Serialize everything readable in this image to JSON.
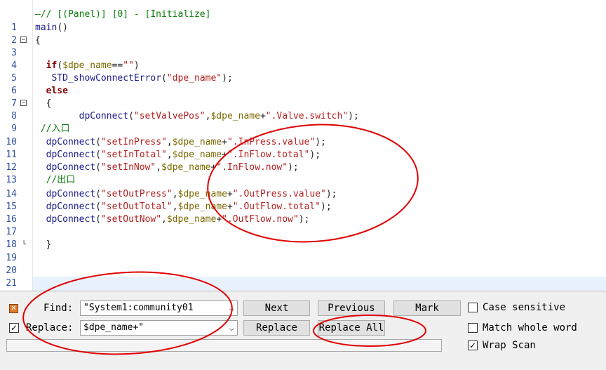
{
  "editor": {
    "lines": [
      {
        "n": "",
        "code": [
          {
            "t": "—// [(Panel)] [0] - [Initialize]",
            "c": "cm"
          }
        ]
      },
      {
        "n": "1",
        "code": [
          {
            "t": "main",
            "c": "fn"
          },
          {
            "t": "()",
            "c": "op"
          }
        ]
      },
      {
        "n": "2",
        "fold": "⊟",
        "code": [
          {
            "t": "{",
            "c": "op"
          }
        ]
      },
      {
        "n": "3",
        "code": []
      },
      {
        "n": "4",
        "code": [
          {
            "t": "  ",
            "c": "op"
          },
          {
            "t": "if",
            "c": "kw"
          },
          {
            "t": "(",
            "c": "op"
          },
          {
            "t": "$dpe_name",
            "c": "var"
          },
          {
            "t": "==",
            "c": "op"
          },
          {
            "t": "\"\"",
            "c": "str"
          },
          {
            "t": ")",
            "c": "op"
          }
        ]
      },
      {
        "n": "5",
        "code": [
          {
            "t": "   ",
            "c": "op"
          },
          {
            "t": "STD_showConnectError",
            "c": "fn"
          },
          {
            "t": "(",
            "c": "op"
          },
          {
            "t": "\"dpe_name\"",
            "c": "str"
          },
          {
            "t": ");",
            "c": "op"
          }
        ]
      },
      {
        "n": "6",
        "code": [
          {
            "t": "  ",
            "c": "op"
          },
          {
            "t": "else",
            "c": "kw"
          }
        ]
      },
      {
        "n": "7",
        "fold": "⊟",
        "code": [
          {
            "t": "  {",
            "c": "op"
          }
        ]
      },
      {
        "n": "8",
        "code": [
          {
            "t": "        ",
            "c": "op"
          },
          {
            "t": "dpConnect",
            "c": "fn"
          },
          {
            "t": "(",
            "c": "op"
          },
          {
            "t": "\"setValvePos\"",
            "c": "str"
          },
          {
            "t": ",",
            "c": "op"
          },
          {
            "t": "$dpe_name",
            "c": "var"
          },
          {
            "t": "+",
            "c": "op"
          },
          {
            "t": "\".Valve.switch\"",
            "c": "str"
          },
          {
            "t": ");",
            "c": "op"
          }
        ]
      },
      {
        "n": "9",
        "code": [
          {
            "t": " //入口",
            "c": "cm"
          }
        ]
      },
      {
        "n": "10",
        "code": [
          {
            "t": "  ",
            "c": "op"
          },
          {
            "t": "dpConnect",
            "c": "fn"
          },
          {
            "t": "(",
            "c": "op"
          },
          {
            "t": "\"setInPress\"",
            "c": "str"
          },
          {
            "t": ",",
            "c": "op"
          },
          {
            "t": "$dpe_name",
            "c": "var"
          },
          {
            "t": "+",
            "c": "op"
          },
          {
            "t": "\".InPress.value\"",
            "c": "str"
          },
          {
            "t": ");",
            "c": "op"
          }
        ]
      },
      {
        "n": "11",
        "code": [
          {
            "t": "  ",
            "c": "op"
          },
          {
            "t": "dpConnect",
            "c": "fn"
          },
          {
            "t": "(",
            "c": "op"
          },
          {
            "t": "\"setInTotal\"",
            "c": "str"
          },
          {
            "t": ",",
            "c": "op"
          },
          {
            "t": "$dpe_name",
            "c": "var"
          },
          {
            "t": "+",
            "c": "op"
          },
          {
            "t": "\".InFlow.total\"",
            "c": "str"
          },
          {
            "t": ");",
            "c": "op"
          }
        ]
      },
      {
        "n": "12",
        "code": [
          {
            "t": "  ",
            "c": "op"
          },
          {
            "t": "dpConnect",
            "c": "fn"
          },
          {
            "t": "(",
            "c": "op"
          },
          {
            "t": "\"setInNow\"",
            "c": "str"
          },
          {
            "t": ",",
            "c": "op"
          },
          {
            "t": "$dpe_name",
            "c": "var"
          },
          {
            "t": "+",
            "c": "op"
          },
          {
            "t": "\".InFlow.now\"",
            "c": "str"
          },
          {
            "t": ");",
            "c": "op"
          }
        ]
      },
      {
        "n": "13",
        "code": [
          {
            "t": "  //出口",
            "c": "cm"
          }
        ]
      },
      {
        "n": "14",
        "code": [
          {
            "t": "  ",
            "c": "op"
          },
          {
            "t": "dpConnect",
            "c": "fn"
          },
          {
            "t": "(",
            "c": "op"
          },
          {
            "t": "\"setOutPress\"",
            "c": "str"
          },
          {
            "t": ",",
            "c": "op"
          },
          {
            "t": "$dpe_name",
            "c": "var"
          },
          {
            "t": "+",
            "c": "op"
          },
          {
            "t": "\".OutPress.value\"",
            "c": "str"
          },
          {
            "t": ");",
            "c": "op"
          }
        ]
      },
      {
        "n": "15",
        "code": [
          {
            "t": "  ",
            "c": "op"
          },
          {
            "t": "dpConnect",
            "c": "fn"
          },
          {
            "t": "(",
            "c": "op"
          },
          {
            "t": "\"setOutTotal\"",
            "c": "str"
          },
          {
            "t": ",",
            "c": "op"
          },
          {
            "t": "$dpe_name",
            "c": "var"
          },
          {
            "t": "+",
            "c": "op"
          },
          {
            "t": "\".OutFlow.total\"",
            "c": "str"
          },
          {
            "t": ");",
            "c": "op"
          }
        ]
      },
      {
        "n": "16",
        "code": [
          {
            "t": "  ",
            "c": "op"
          },
          {
            "t": "dpConnect",
            "c": "fn"
          },
          {
            "t": "(",
            "c": "op"
          },
          {
            "t": "\"setOutNow\"",
            "c": "str"
          },
          {
            "t": ",",
            "c": "op"
          },
          {
            "t": "$dpe_name",
            "c": "var"
          },
          {
            "t": "+",
            "c": "op"
          },
          {
            "t": "\".OutFlow.now\"",
            "c": "str"
          },
          {
            "t": ");",
            "c": "op"
          }
        ]
      },
      {
        "n": "17",
        "code": []
      },
      {
        "n": "18",
        "foldend": "└",
        "code": [
          {
            "t": "  }",
            "c": "op"
          }
        ]
      },
      {
        "n": "19",
        "code": []
      },
      {
        "n": "20",
        "code": []
      },
      {
        "n": "21",
        "code": []
      }
    ]
  },
  "find_bar": {
    "close_icon": "close-icon",
    "find_label": "Find:",
    "find_value": "\"System1:community01",
    "replace_checked": true,
    "replace_label": "Replace:",
    "replace_value": "$dpe_name+\"",
    "next_label": "Next",
    "previous_label": "Previous",
    "mark_label": "Mark",
    "replace_label_btn": "Replace",
    "replace_all_label": "Replace All",
    "case_sensitive_label": "Case sensitive",
    "case_sensitive_checked": false,
    "match_whole_word_label": "Match whole word",
    "match_whole_word_checked": false,
    "wrap_scan_label": "Wrap Scan",
    "wrap_scan_checked": true
  },
  "colors": {
    "annotation": "#e00000",
    "accent_close": "#e07b2a"
  }
}
